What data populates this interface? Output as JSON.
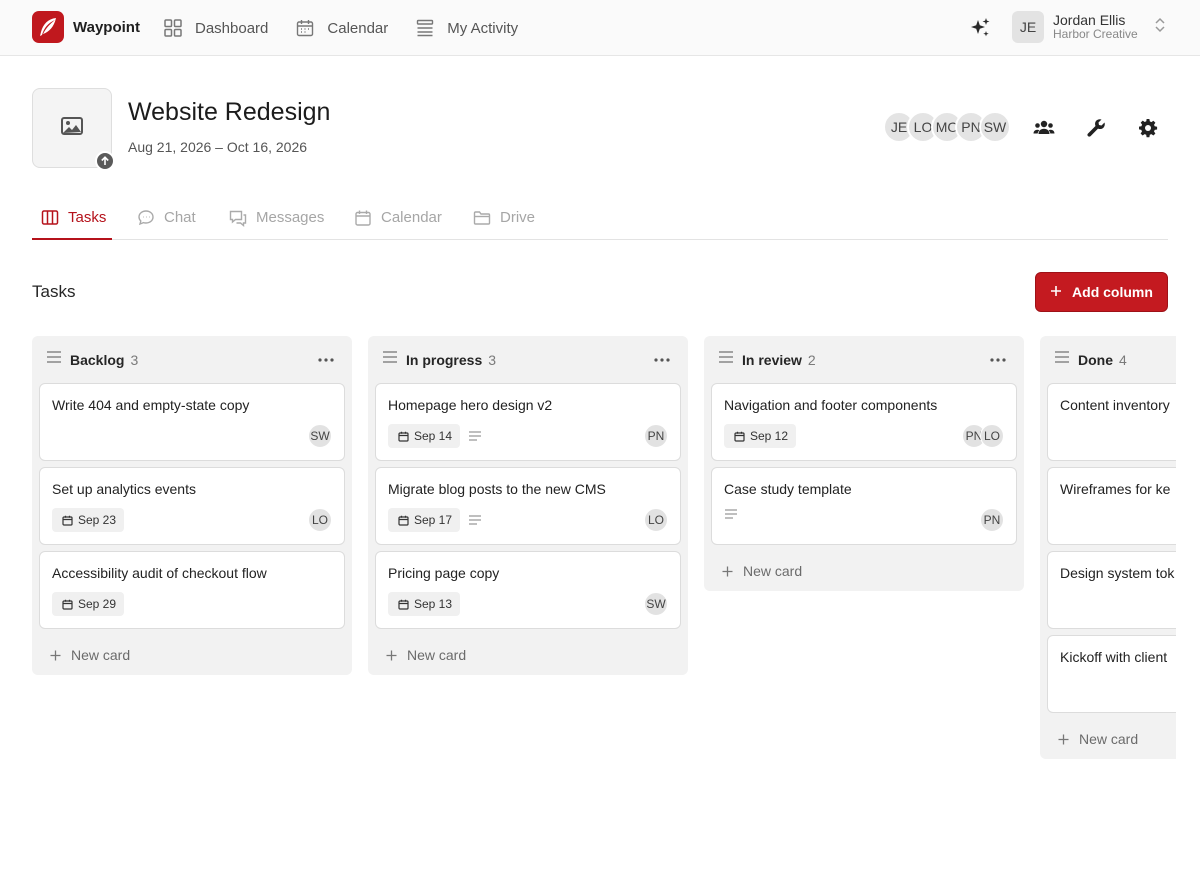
{
  "app": {
    "name": "Waypoint",
    "brand_color": "#c0181e"
  },
  "nav": {
    "items": [
      {
        "label": "Dashboard",
        "icon": "grid-icon"
      },
      {
        "label": "Calendar",
        "icon": "calendar-icon"
      },
      {
        "label": "My Activity",
        "icon": "list-icon"
      }
    ]
  },
  "account": {
    "initials": "JE",
    "name": "Jordan Ellis",
    "org": "Harbor Creative"
  },
  "project": {
    "title": "Website Redesign",
    "dates": "Aug 21, 2026 – Oct 16, 2026",
    "members": [
      "JE",
      "LO",
      "MO",
      "PN",
      "SW"
    ]
  },
  "tabs": [
    {
      "label": "Tasks",
      "icon": "columns-icon",
      "active": true
    },
    {
      "label": "Chat",
      "icon": "chat-bubble-icon",
      "active": false
    },
    {
      "label": "Messages",
      "icon": "messages-icon",
      "active": false
    },
    {
      "label": "Calendar",
      "icon": "calendar-icon",
      "active": false
    },
    {
      "label": "Drive",
      "icon": "folder-icon",
      "active": false
    }
  ],
  "section": {
    "title": "Tasks",
    "add_column_label": "Add column"
  },
  "new_card_label": "New card",
  "columns": [
    {
      "title": "Backlog",
      "count": "3",
      "cards": [
        {
          "title": "Write 404 and empty-state copy",
          "date": "",
          "has_description": false,
          "assignees": [
            "SW"
          ]
        },
        {
          "title": "Set up analytics events",
          "date": "Sep 23",
          "has_description": false,
          "assignees": [
            "LO"
          ]
        },
        {
          "title": "Accessibility audit of checkout flow",
          "date": "Sep 29",
          "has_description": false,
          "assignees": []
        }
      ]
    },
    {
      "title": "In progress",
      "count": "3",
      "cards": [
        {
          "title": "Homepage hero design v2",
          "date": "Sep 14",
          "has_description": true,
          "assignees": [
            "PN"
          ]
        },
        {
          "title": "Migrate blog posts to the new CMS",
          "date": "Sep 17",
          "has_description": true,
          "assignees": [
            "LO"
          ]
        },
        {
          "title": "Pricing page copy",
          "date": "Sep 13",
          "has_description": false,
          "assignees": [
            "SW"
          ]
        }
      ]
    },
    {
      "title": "In review",
      "count": "2",
      "cards": [
        {
          "title": "Navigation and footer components",
          "date": "Sep 12",
          "has_description": false,
          "assignees": [
            "PN",
            "LO"
          ]
        },
        {
          "title": "Case study template",
          "date": "",
          "has_description": true,
          "assignees": [
            "PN"
          ]
        }
      ]
    },
    {
      "title": "Done",
      "count": "4",
      "cards": [
        {
          "title": "Content inventory",
          "date": "",
          "has_description": false,
          "assignees": []
        },
        {
          "title": "Wireframes for ke",
          "date": "",
          "has_description": false,
          "assignees": []
        },
        {
          "title": "Design system tok",
          "date": "",
          "has_description": false,
          "assignees": []
        },
        {
          "title": "Kickoff with client",
          "date": "",
          "has_description": false,
          "assignees": []
        }
      ]
    }
  ]
}
